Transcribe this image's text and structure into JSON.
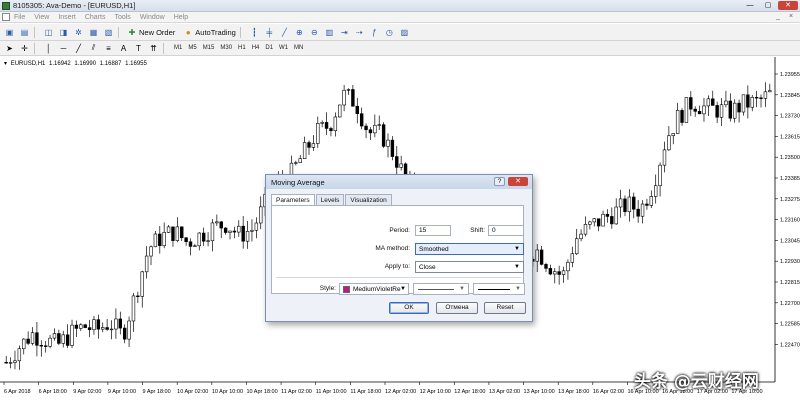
{
  "window": {
    "title": "8105305: Ava-Demo - [EURUSD,H1]",
    "min_label": "—",
    "max_label": "▢",
    "close_label": "✕"
  },
  "menu": {
    "items": [
      "File",
      "View",
      "Insert",
      "Charts",
      "Tools",
      "Window",
      "Help"
    ],
    "mdi_min": "_",
    "mdi_close": "×"
  },
  "toolbar": {
    "new_order_label": "New Order",
    "autotrading_label": "AutoTrading",
    "timeframes": [
      "M1",
      "M5",
      "M15",
      "M30",
      "H1",
      "H4",
      "D1",
      "W1",
      "MN"
    ]
  },
  "chart": {
    "symbol": "EURUSD,H1",
    "ohlc": [
      "1.16942",
      "1.16990",
      "1.16887",
      "1.16955"
    ],
    "colors": {
      "candle": "#000000",
      "grid": "#e6e6e6"
    }
  },
  "chart_data": {
    "type": "candlestick",
    "symbol": "EURUSD",
    "timeframe": "H1",
    "y_ticks": [
      "1.23955",
      "1.23845",
      "1.23730",
      "1.23615",
      "1.23500",
      "1.23385",
      "1.23275",
      "1.23160",
      "1.23045",
      "1.22930",
      "1.22815",
      "1.22700",
      "1.22585",
      "1.22470"
    ],
    "x_ticks": [
      "6 Apr 2018",
      "6 Apr 18:00",
      "9 Apr 02:00",
      "9 Apr 10:00",
      "9 Apr 18:00",
      "10 Apr 02:00",
      "10 Apr 10:00",
      "10 Apr 18:00",
      "11 Apr 02:00",
      "11 Apr 10:00",
      "11 Apr 18:00",
      "12 Apr 02:00",
      "12 Apr 10:00",
      "12 Apr 18:00",
      "13 Apr 02:00",
      "13 Apr 10:00",
      "13 Apr 18:00",
      "16 Apr 02:00",
      "16 Apr 10:00",
      "16 Apr 18:00",
      "17 Apr 02:00",
      "17 Apr 10:00"
    ],
    "ylim": [
      1.22382,
      1.24014
    ],
    "close_path": [
      1.2247,
      1.2255,
      1.2262,
      1.2259,
      1.2256,
      1.2262,
      1.2266,
      1.2264,
      1.2268,
      1.2261,
      1.2283,
      1.2307,
      1.2313,
      1.2316,
      1.231,
      1.2314,
      1.2318,
      1.232,
      1.2314,
      1.2317,
      1.233,
      1.234,
      1.2346,
      1.2357,
      1.2368,
      1.2372,
      1.2388,
      1.2384,
      1.2368,
      1.2367,
      1.2356,
      1.2341,
      1.2328,
      1.232,
      1.2327,
      1.234,
      1.2333,
      1.2326,
      1.232,
      1.2312,
      1.2303,
      1.2306,
      1.2298,
      1.2292,
      1.2312,
      1.2318,
      1.2322,
      1.2326,
      1.233,
      1.2327,
      1.2341,
      1.2365,
      1.2377,
      1.2384,
      1.2381,
      1.238,
      1.2379,
      1.2383,
      1.2384,
      1.2388
    ],
    "grid": false
  },
  "dialog": {
    "title": "Moving Average",
    "help_label": "?",
    "close_label": "✕",
    "tabs": [
      "Parameters",
      "Levels",
      "Visualization"
    ],
    "period_label": "Period:",
    "period_value": "15",
    "shift_label": "Shift:",
    "shift_value": "0",
    "ma_method_label": "MA method:",
    "ma_method_value": "Smoothed",
    "apply_to_label": "Apply to:",
    "apply_to_value": "Close",
    "style_label": "Style:",
    "color_name": "MediumVioletRe",
    "color_hex": "#c71585",
    "ok_label": "OK",
    "cancel_label": "Отмена",
    "reset_label": "Reset"
  },
  "watermark": "头条 @云财经网"
}
